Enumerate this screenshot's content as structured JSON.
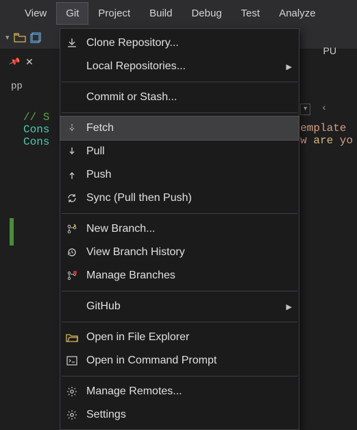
{
  "menubar": {
    "items": [
      "View",
      "Git",
      "Project",
      "Build",
      "Debug",
      "Test",
      "Analyze"
    ],
    "active_index": 1
  },
  "cpu_label": "PU",
  "tab": {
    "name": "pp",
    "pinned": true
  },
  "editor": {
    "comment": "// S",
    "type_token": "Cons",
    "right_snippet_1": "emplate",
    "right_snippet_2": "w ",
    "right_snippet_3": "are",
    "right_snippet_4": " yo"
  },
  "dropdown": [
    {
      "icon": "clone-icon",
      "label": "Clone Repository..."
    },
    {
      "icon": "",
      "label": "Local Repositories...",
      "submenu": true,
      "indent": true
    },
    {
      "sep": true
    },
    {
      "icon": "",
      "label": "Commit or Stash...",
      "indent": true
    },
    {
      "sep": true
    },
    {
      "icon": "fetch-icon",
      "label": "Fetch",
      "hover": true
    },
    {
      "icon": "pull-icon",
      "label": "Pull"
    },
    {
      "icon": "push-icon",
      "label": "Push"
    },
    {
      "icon": "sync-icon",
      "label": "Sync (Pull then Push)"
    },
    {
      "sep": true
    },
    {
      "icon": "branch-new-icon",
      "label": "New Branch..."
    },
    {
      "icon": "history-icon",
      "label": "View Branch History"
    },
    {
      "icon": "branches-icon",
      "label": "Manage Branches"
    },
    {
      "sep": true
    },
    {
      "icon": "",
      "label": "GitHub",
      "submenu": true,
      "indent": true
    },
    {
      "sep": true
    },
    {
      "icon": "folder-open-icon",
      "label": "Open in File Explorer"
    },
    {
      "icon": "terminal-icon",
      "label": "Open in Command Prompt"
    },
    {
      "sep": true
    },
    {
      "icon": "gear-icon",
      "label": "Manage Remotes..."
    },
    {
      "icon": "gear-icon",
      "label": "Settings"
    }
  ]
}
